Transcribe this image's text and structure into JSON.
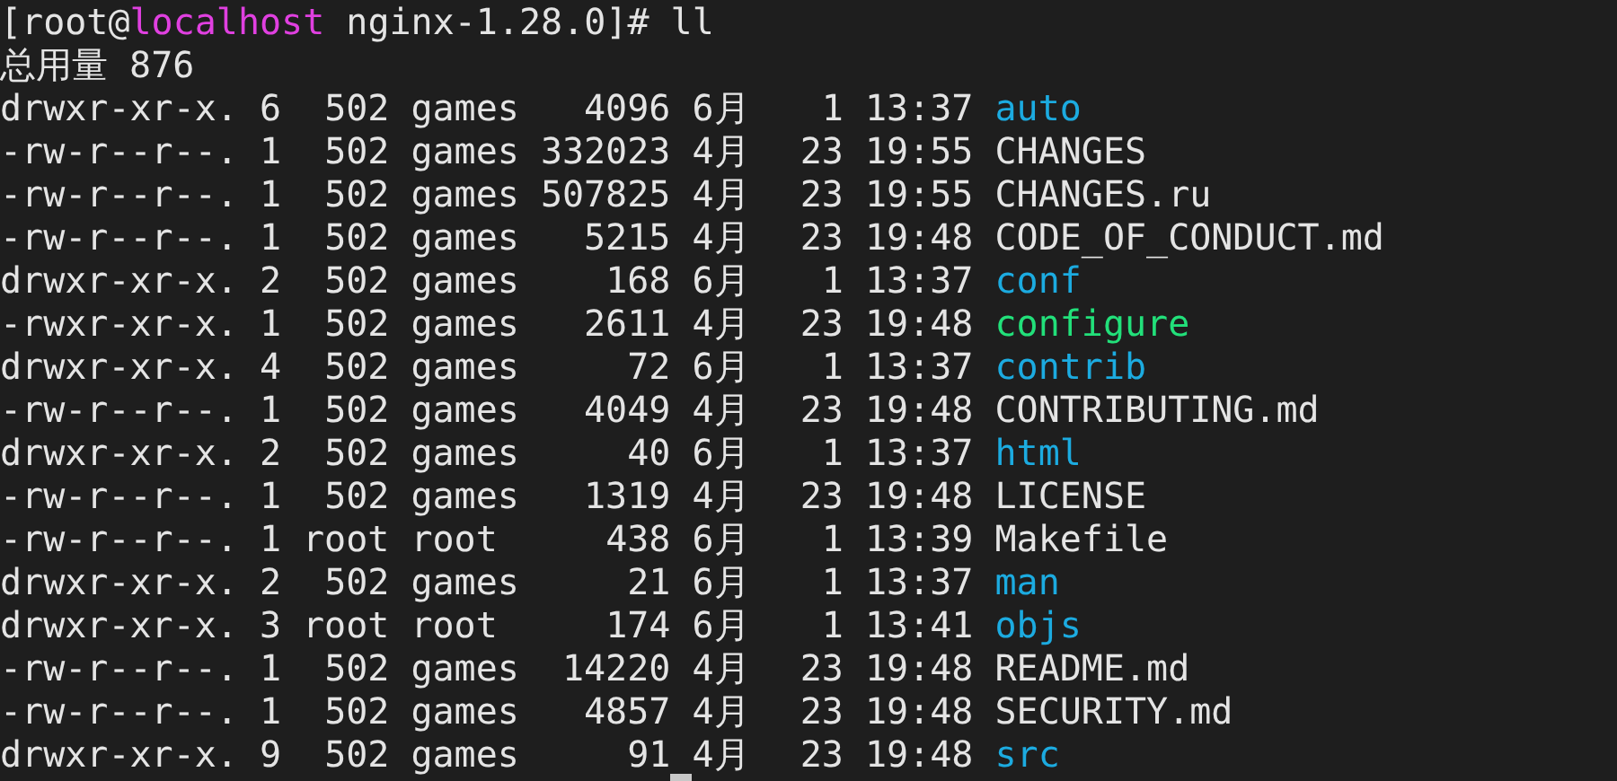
{
  "prompt": {
    "user": "[root@",
    "host": "localhost",
    "rest": " nginx-1.28.0]# ll"
  },
  "total": "总用量 876",
  "entries": [
    {
      "perms": "drwxr-xr-x.",
      "links": "6",
      "owner": "502",
      "group": "games",
      "size": "4096",
      "month": "6月",
      "day": "1",
      "time": "13:37",
      "name": "auto",
      "kind": "dir"
    },
    {
      "perms": "-rw-r--r--.",
      "links": "1",
      "owner": "502",
      "group": "games",
      "size": "332023",
      "month": "4月",
      "day": "23",
      "time": "19:55",
      "name": "CHANGES",
      "kind": "file"
    },
    {
      "perms": "-rw-r--r--.",
      "links": "1",
      "owner": "502",
      "group": "games",
      "size": "507825",
      "month": "4月",
      "day": "23",
      "time": "19:55",
      "name": "CHANGES.ru",
      "kind": "file"
    },
    {
      "perms": "-rw-r--r--.",
      "links": "1",
      "owner": "502",
      "group": "games",
      "size": "5215",
      "month": "4月",
      "day": "23",
      "time": "19:48",
      "name": "CODE_OF_CONDUCT.md",
      "kind": "file"
    },
    {
      "perms": "drwxr-xr-x.",
      "links": "2",
      "owner": "502",
      "group": "games",
      "size": "168",
      "month": "6月",
      "day": "1",
      "time": "13:37",
      "name": "conf",
      "kind": "dir"
    },
    {
      "perms": "-rwxr-xr-x.",
      "links": "1",
      "owner": "502",
      "group": "games",
      "size": "2611",
      "month": "4月",
      "day": "23",
      "time": "19:48",
      "name": "configure",
      "kind": "exec"
    },
    {
      "perms": "drwxr-xr-x.",
      "links": "4",
      "owner": "502",
      "group": "games",
      "size": "72",
      "month": "6月",
      "day": "1",
      "time": "13:37",
      "name": "contrib",
      "kind": "dir"
    },
    {
      "perms": "-rw-r--r--.",
      "links": "1",
      "owner": "502",
      "group": "games",
      "size": "4049",
      "month": "4月",
      "day": "23",
      "time": "19:48",
      "name": "CONTRIBUTING.md",
      "kind": "file"
    },
    {
      "perms": "drwxr-xr-x.",
      "links": "2",
      "owner": "502",
      "group": "games",
      "size": "40",
      "month": "6月",
      "day": "1",
      "time": "13:37",
      "name": "html",
      "kind": "dir"
    },
    {
      "perms": "-rw-r--r--.",
      "links": "1",
      "owner": "502",
      "group": "games",
      "size": "1319",
      "month": "4月",
      "day": "23",
      "time": "19:48",
      "name": "LICENSE",
      "kind": "file"
    },
    {
      "perms": "-rw-r--r--.",
      "links": "1",
      "owner": "root",
      "group": "root",
      "size": "438",
      "month": "6月",
      "day": "1",
      "time": "13:39",
      "name": "Makefile",
      "kind": "file"
    },
    {
      "perms": "drwxr-xr-x.",
      "links": "2",
      "owner": "502",
      "group": "games",
      "size": "21",
      "month": "6月",
      "day": "1",
      "time": "13:37",
      "name": "man",
      "kind": "dir"
    },
    {
      "perms": "drwxr-xr-x.",
      "links": "3",
      "owner": "root",
      "group": "root",
      "size": "174",
      "month": "6月",
      "day": "1",
      "time": "13:41",
      "name": "objs",
      "kind": "dir"
    },
    {
      "perms": "-rw-r--r--.",
      "links": "1",
      "owner": "502",
      "group": "games",
      "size": "14220",
      "month": "4月",
      "day": "23",
      "time": "19:48",
      "name": "README.md",
      "kind": "file"
    },
    {
      "perms": "-rw-r--r--.",
      "links": "1",
      "owner": "502",
      "group": "games",
      "size": "4857",
      "month": "4月",
      "day": "23",
      "time": "19:48",
      "name": "SECURITY.md",
      "kind": "file"
    },
    {
      "perms": "drwxr-xr-x.",
      "links": "9",
      "owner": "502",
      "group": "games",
      "size": "91",
      "month": "4月",
      "day": "23",
      "time": "19:48",
      "name": "src",
      "kind": "dir"
    }
  ]
}
